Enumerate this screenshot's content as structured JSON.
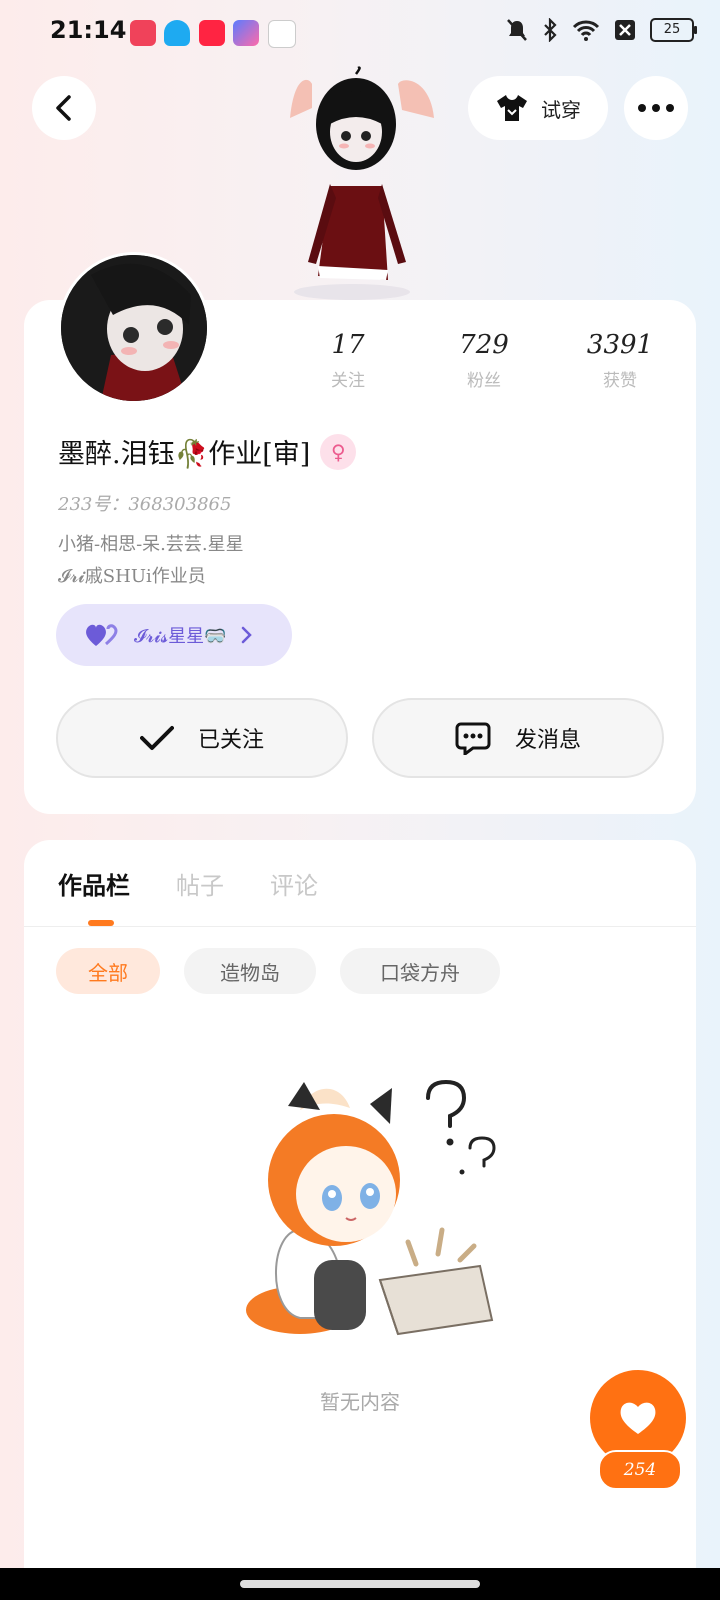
{
  "status_bar": {
    "time": "21:14",
    "battery": "25",
    "icons": [
      "screen-record-icon",
      "qq-icon",
      "xiaohongshu-icon",
      "shortcut-icon",
      "app-icon",
      "mute-icon",
      "bluetooth-icon",
      "wifi-icon",
      "no-sim-icon",
      "battery-icon"
    ]
  },
  "header": {
    "try_on_label": "试穿"
  },
  "stats": [
    {
      "value": "17",
      "label": "关注"
    },
    {
      "value": "729",
      "label": "粉丝"
    },
    {
      "value": "3391",
      "label": "获赞"
    }
  ],
  "profile": {
    "name": "墨醉.泪钰🥀作业[审]",
    "gender_symbol": "♀",
    "uid": "233号：368303865",
    "bio_line1": "小猪-相思-呆.芸芸.星星",
    "bio_line2": "𝓘𝓻𝓲戚SHUi作业员",
    "fan_badge_label": "𝓘𝓻𝓲𝓼星星🥽"
  },
  "actions": {
    "follow_label": "已关注",
    "message_label": "发消息"
  },
  "tabs": [
    "作品栏",
    "帖子",
    "评论"
  ],
  "filters": [
    "全部",
    "造物岛",
    "口袋方舟"
  ],
  "empty": {
    "text": "暂无内容"
  },
  "like": {
    "count": "254"
  },
  "colors": {
    "accent": "#ff7112",
    "badge_bg": "#e7e4fb",
    "badge_text": "#6c5bd8"
  }
}
